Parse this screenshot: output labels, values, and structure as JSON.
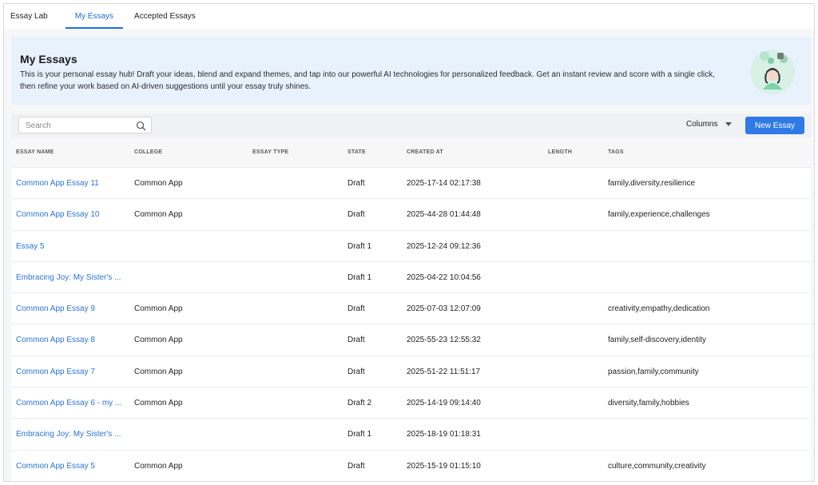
{
  "tabs": [
    {
      "label": "Essay Lab",
      "active": false
    },
    {
      "label": "My Essays",
      "active": true
    },
    {
      "label": "Accepted Essays",
      "active": false
    }
  ],
  "hero": {
    "title": "My Essays",
    "description": "This is your personal essay hub! Draft your ideas, blend and expand themes, and tap into our powerful AI technologies for personalized feedback. Get an instant review and score with a single click, then refine your work based on AI-driven suggestions until your essay truly shines."
  },
  "toolbar": {
    "search_placeholder": "Search",
    "search_value": "",
    "columns_label": "Columns",
    "new_button_label": "New Essay"
  },
  "table": {
    "headers": [
      "ESSAY NAME",
      "COLLEGE",
      "ESSAY TYPE",
      "STATE",
      "CREATED AT",
      "LENGTH",
      "TAGS"
    ],
    "rows": [
      {
        "name": "Common App Essay 11",
        "college": "Common App",
        "type": "",
        "state": "Draft",
        "created": "2025-17-14 02:17:38",
        "length": "",
        "tags": "family,diversity,resilience"
      },
      {
        "name": "Common App Essay 10",
        "college": "Common App",
        "type": "",
        "state": "Draft",
        "created": "2025-44-28 01:44:48",
        "length": "",
        "tags": "family,experience,challenges"
      },
      {
        "name": "Essay 5",
        "college": "",
        "type": "",
        "state": "Draft 1",
        "created": "2025-12-24 09:12:36",
        "length": "",
        "tags": ""
      },
      {
        "name": "Embracing Joy: My Sister's ...",
        "college": "",
        "type": "",
        "state": "Draft 1",
        "created": "2025-04-22 10:04:56",
        "length": "",
        "tags": ""
      },
      {
        "name": "Common App Essay 9",
        "college": "Common App",
        "type": "",
        "state": "Draft",
        "created": "2025-07-03 12:07:09",
        "length": "",
        "tags": "creativity,empathy,dedication"
      },
      {
        "name": "Common App Essay 8",
        "college": "Common App",
        "type": "",
        "state": "Draft",
        "created": "2025-55-23 12:55:32",
        "length": "",
        "tags": "family,self-discovery,identity"
      },
      {
        "name": "Common App Essay 7",
        "college": "Common App",
        "type": "",
        "state": "Draft",
        "created": "2025-51-22 11:51:17",
        "length": "",
        "tags": "passion,family,community"
      },
      {
        "name": "Common App Essay 6 - my ...",
        "college": "Common App",
        "type": "",
        "state": "Draft 2",
        "created": "2025-14-19 09:14:40",
        "length": "",
        "tags": "diversity,family,hobbies"
      },
      {
        "name": "Embracing Joy: My Sister's ...",
        "college": "",
        "type": "",
        "state": "Draft 1",
        "created": "2025-18-19 01:18:31",
        "length": "",
        "tags": ""
      },
      {
        "name": "Common App Essay 5",
        "college": "Common App",
        "type": "",
        "state": "Draft",
        "created": "2025-15-19 01:15:10",
        "length": "",
        "tags": "culture,community,creativity"
      }
    ]
  },
  "colors": {
    "accent": "#2f7ae5",
    "link": "#2b74d6",
    "hero_bg": "#e8f2fd"
  },
  "icons": {
    "search": "search-icon",
    "columns_caret": "caret-down-icon",
    "hero_art": "student-illustration-icon"
  }
}
